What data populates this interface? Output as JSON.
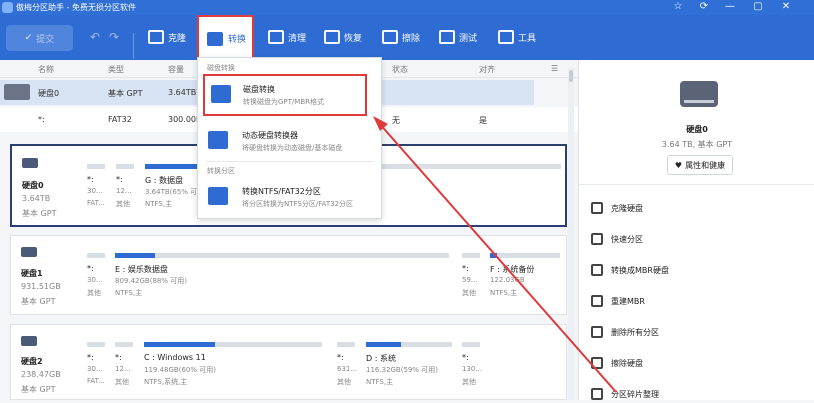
{
  "titlebar": {
    "title": "傲梅分区助手 - 免费无损分区软件",
    "star": "☆",
    "refresh": "⟳",
    "min": "—",
    "max": "▢"
  },
  "toolbar": {
    "submit": "提交",
    "undo": "↶",
    "redo": "↷",
    "clone": "克隆",
    "convert": "转换",
    "clean": "清理",
    "recover": "恢复",
    "wipe": "擦除",
    "test": "测试",
    "tools": "工具"
  },
  "columns": [
    "名称",
    "类型",
    "容量",
    "状态",
    "对齐"
  ],
  "list_rows": [
    {
      "name": "硬盘0",
      "type": "基本 GPT",
      "capacity": "3.64TB"
    },
    {
      "name": "*:",
      "type": "FAT32",
      "capacity": "300.00M",
      "status": "无",
      "align": "是"
    }
  ],
  "disks": [
    {
      "name": "硬盘0",
      "size": "3.64TB",
      "style": "基本 GPT",
      "parts": [
        {
          "name": "*:",
          "size": "30...",
          "fs": "FAT...",
          "fill": 0
        },
        {
          "name": "*:",
          "size": "12...",
          "fs": "其他",
          "fill": 0
        },
        {
          "name": "G : 数据盘",
          "size": "3.64TB(65% 可用)",
          "fs": "NTFS,主",
          "fill": 0.35
        }
      ]
    },
    {
      "name": "硬盘1",
      "size": "931.51GB",
      "style": "基本 GPT",
      "parts": [
        {
          "name": "*:",
          "size": "30...",
          "fs": "其他",
          "fill": 0
        },
        {
          "name": "E : 娱乐数据盘",
          "size": "809.42GB(88% 可用)",
          "fs": "NTFS,主",
          "fill": 0.12
        },
        {
          "name": "*:",
          "size": "59...",
          "fs": "其他",
          "fill": 0
        },
        {
          "name": "F : 系统备份",
          "size": "122.03GB",
          "fs": "NTFS,主",
          "fill": 0.1
        }
      ]
    },
    {
      "name": "硬盘2",
      "size": "238.47GB",
      "style": "基本 GPT",
      "parts": [
        {
          "name": "*:",
          "size": "30...",
          "fs": "FAT...",
          "fill": 0
        },
        {
          "name": "*:",
          "size": "12...",
          "fs": "其他",
          "fill": 0
        },
        {
          "name": "C : Windows 11",
          "size": "119.48GB(60% 可用)",
          "fs": "NTFS,系统,主",
          "fill": 0.4
        },
        {
          "name": "*:",
          "size": "631...",
          "fs": "其他",
          "fill": 0
        },
        {
          "name": "D : 系统",
          "size": "116.32GB(59% 可用)",
          "fs": "NTFS,主",
          "fill": 0.41
        },
        {
          "name": "*:",
          "size": "130...",
          "fs": "其他",
          "fill": 0
        }
      ]
    }
  ],
  "dropdown": {
    "sec1": "磁盘转换",
    "item1_title": "磁盘转换",
    "item1_desc": "转换磁盘为GPT/MBR格式",
    "item2_title": "动态硬盘转换器",
    "item2_desc": "将硬盘转换为动态磁盘/基本磁盘",
    "sec2": "转换分区",
    "item3_title": "转换NTFS/FAT32分区",
    "item3_desc": "将分区转换为NTFS分区/FAT32分区"
  },
  "right_panel": {
    "disk_name": "硬盘0",
    "disk_sub": "3.64 TB, 基本 GPT",
    "props": "属性和健康",
    "ops": [
      "克隆硬盘",
      "快速分区",
      "转换成MBR硬盘",
      "重建MBR",
      "删除所有分区",
      "擦除硬盘",
      "分区碎片整理"
    ]
  },
  "colors": {
    "accent": "#2e6bd3",
    "highlight": "#e03a3a"
  }
}
